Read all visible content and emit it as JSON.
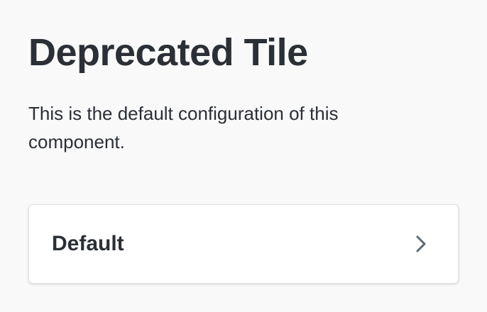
{
  "page": {
    "title": "Deprecated Tile",
    "description": "This is the default configuration of this component."
  },
  "tile": {
    "label": "Default",
    "icon": "chevron-right-icon",
    "icon_color": "#5b6875"
  },
  "colors": {
    "background": "#f9f9f9",
    "text": "#2b2f36",
    "tile_background": "#ffffff",
    "tile_border": "#e3e4e7"
  }
}
